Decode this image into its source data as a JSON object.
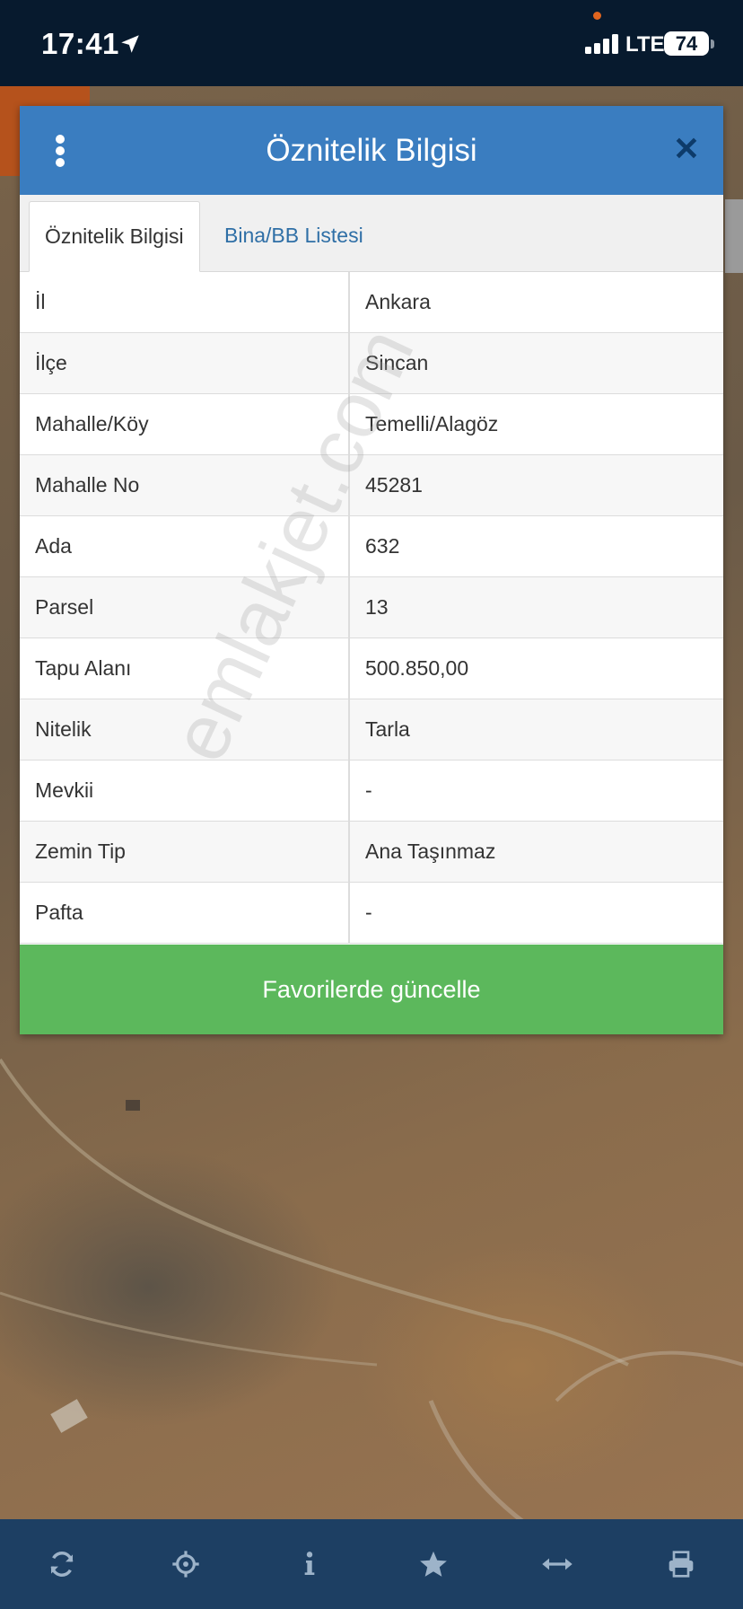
{
  "status_bar": {
    "time": "17:41",
    "network": "LTE",
    "battery": "74",
    "icons": [
      "location-arrow-icon",
      "signal-icon",
      "battery-icon"
    ]
  },
  "modal": {
    "title": "Öznitelik Bilgisi",
    "menu_icon": "menu-dots-icon",
    "close_icon": "close-icon",
    "tabs": [
      {
        "label": "Öznitelik Bilgisi",
        "active": true
      },
      {
        "label": "Bina/BB Listesi",
        "active": false
      }
    ],
    "rows": [
      {
        "key": "İl",
        "value": "Ankara"
      },
      {
        "key": "İlçe",
        "value": "Sincan"
      },
      {
        "key": "Mahalle/Köy",
        "value": "Temelli/Alagöz"
      },
      {
        "key": "Mahalle No",
        "value": "45281"
      },
      {
        "key": "Ada",
        "value": "632"
      },
      {
        "key": "Parsel",
        "value": "13"
      },
      {
        "key": "Tapu Alanı",
        "value": "500.850,00"
      },
      {
        "key": "Nitelik",
        "value": "Tarla"
      },
      {
        "key": "Mevkii",
        "value": "-"
      },
      {
        "key": "Zemin Tip",
        "value": "Ana Taşınmaz"
      },
      {
        "key": "Pafta",
        "value": "-"
      }
    ],
    "update_button": "Favorilerde güncelle"
  },
  "watermark": "emlakjet.com",
  "toolbar": {
    "icons": [
      "refresh-icon",
      "crosshair-icon",
      "info-icon",
      "star-icon",
      "measure-icon",
      "print-icon"
    ]
  },
  "colors": {
    "header": "#3a7dc0",
    "button": "#5cb85c",
    "toolbar": "#1d3f63",
    "status_bar": "#071a2e"
  }
}
